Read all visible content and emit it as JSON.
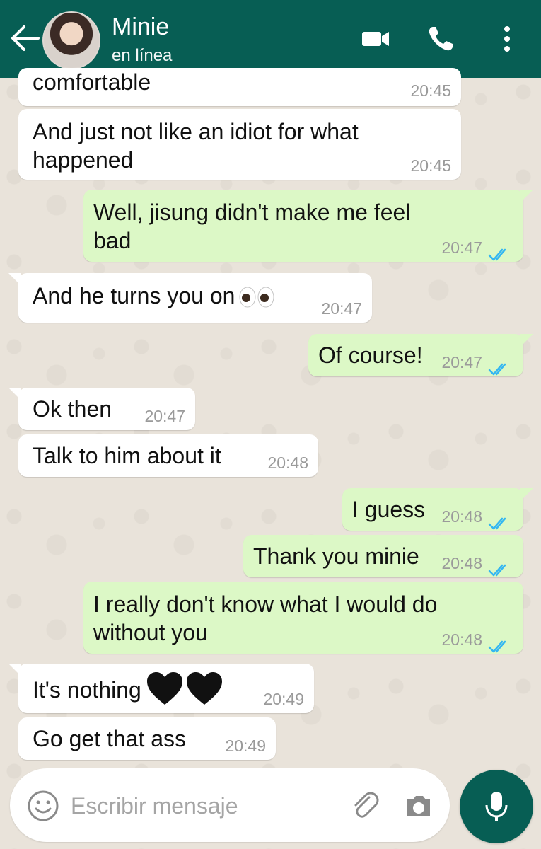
{
  "header": {
    "contact_name": "Minie",
    "status": "en línea",
    "icons": {
      "back": "back-arrow-icon",
      "video": "video-call-icon",
      "call": "phone-call-icon",
      "menu": "more-options-icon"
    },
    "colors": {
      "bar": "#075e54"
    }
  },
  "messages": [
    {
      "direction": "incoming",
      "text": "comfortable",
      "time": "20:45"
    },
    {
      "direction": "incoming",
      "text": "And just not like an idiot for what happened",
      "time": "20:45"
    },
    {
      "direction": "outgoing",
      "text": "Well, jisung didn't make me feel bad",
      "time": "20:47",
      "status": "read"
    },
    {
      "direction": "incoming",
      "text": "And he turns you on",
      "emoji": "eyes",
      "time": "20:47"
    },
    {
      "direction": "outgoing",
      "text": "Of course!",
      "time": "20:47",
      "status": "read"
    },
    {
      "direction": "incoming",
      "text": "Ok then",
      "time": "20:47"
    },
    {
      "direction": "incoming",
      "text": "Talk to him about it",
      "time": "20:48"
    },
    {
      "direction": "outgoing",
      "text": "I guess",
      "time": "20:48",
      "status": "read"
    },
    {
      "direction": "outgoing",
      "text": "Thank you minie",
      "time": "20:48",
      "status": "read"
    },
    {
      "direction": "outgoing",
      "text": "I really don't know what I would do without you",
      "time": "20:48",
      "status": "read"
    },
    {
      "direction": "incoming",
      "text": "It's nothing",
      "emoji": "two-black-hearts",
      "time": "20:49"
    },
    {
      "direction": "incoming",
      "text": "Go get that ass",
      "time": "20:49"
    }
  ],
  "composer": {
    "placeholder": "Escribir mensaje",
    "icons": {
      "emoji": "emoji-icon",
      "attach": "attach-icon",
      "camera": "camera-icon",
      "mic": "mic-icon"
    }
  },
  "colors": {
    "incoming_bubble": "#ffffff",
    "outgoing_bubble": "#dcf8c6",
    "read_ticks": "#34b7f1",
    "mic_button": "#075e54"
  }
}
